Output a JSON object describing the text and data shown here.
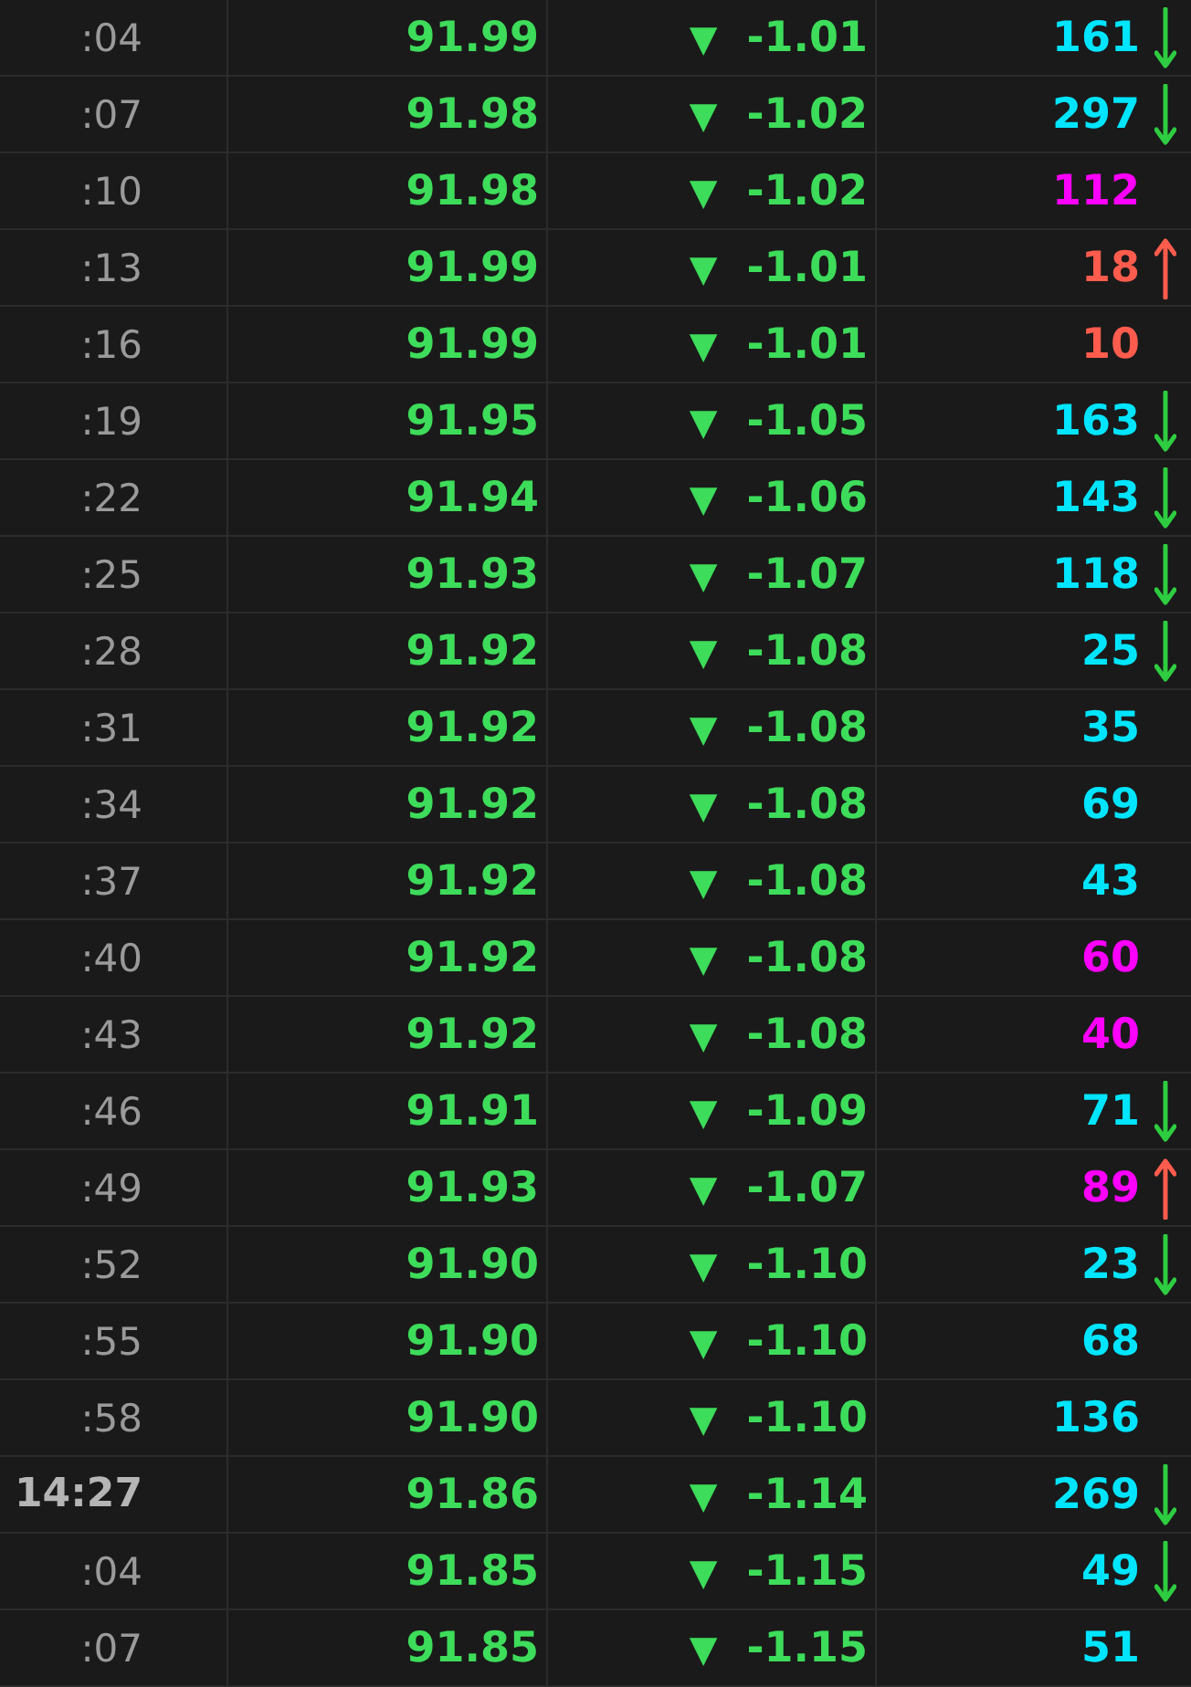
{
  "rows": [
    {
      "time": ":04",
      "time_bold": false,
      "price": "91.99",
      "change_mark": "▼",
      "change": "-1.01",
      "volume": "161",
      "color": "#00e5ff",
      "arrow_down": true,
      "arrow_up": false
    },
    {
      "time": ":07",
      "time_bold": false,
      "price": "91.98",
      "change_mark": "▼",
      "change": "-1.02",
      "volume": "297",
      "color": "#00e5ff",
      "arrow_down": true,
      "arrow_up": false
    },
    {
      "time": ":10",
      "time_bold": false,
      "price": "91.98",
      "change_mark": "▼",
      "change": "-1.02",
      "volume": "112",
      "color": "#ff00ff",
      "arrow_down": false,
      "arrow_up": false
    },
    {
      "time": ":13",
      "time_bold": false,
      "price": "91.99",
      "change_mark": "▼",
      "change": "-1.01",
      "volume": "18",
      "color": "#ff5c4d",
      "arrow_down": false,
      "arrow_up": true
    },
    {
      "time": ":16",
      "time_bold": false,
      "price": "91.99",
      "change_mark": "▼",
      "change": "-1.01",
      "volume": "10",
      "color": "#ff5c4d",
      "arrow_down": false,
      "arrow_up": false
    },
    {
      "time": ":19",
      "time_bold": false,
      "price": "91.95",
      "change_mark": "▼",
      "change": "-1.05",
      "volume": "163",
      "color": "#00e5ff",
      "arrow_down": true,
      "arrow_up": false
    },
    {
      "time": ":22",
      "time_bold": false,
      "price": "91.94",
      "change_mark": "▼",
      "change": "-1.06",
      "volume": "143",
      "color": "#00e5ff",
      "arrow_down": true,
      "arrow_up": false
    },
    {
      "time": ":25",
      "time_bold": false,
      "price": "91.93",
      "change_mark": "▼",
      "change": "-1.07",
      "volume": "118",
      "color": "#00e5ff",
      "arrow_down": true,
      "arrow_up": false
    },
    {
      "time": ":28",
      "time_bold": false,
      "price": "91.92",
      "change_mark": "▼",
      "change": "-1.08",
      "volume": "25",
      "color": "#00e5ff",
      "arrow_down": true,
      "arrow_up": false
    },
    {
      "time": ":31",
      "time_bold": false,
      "price": "91.92",
      "change_mark": "▼",
      "change": "-1.08",
      "volume": "35",
      "color": "#00e5ff",
      "arrow_down": false,
      "arrow_up": false
    },
    {
      "time": ":34",
      "time_bold": false,
      "price": "91.92",
      "change_mark": "▼",
      "change": "-1.08",
      "volume": "69",
      "color": "#00e5ff",
      "arrow_down": false,
      "arrow_up": false
    },
    {
      "time": ":37",
      "time_bold": false,
      "price": "91.92",
      "change_mark": "▼",
      "change": "-1.08",
      "volume": "43",
      "color": "#00e5ff",
      "arrow_down": false,
      "arrow_up": false
    },
    {
      "time": ":40",
      "time_bold": false,
      "price": "91.92",
      "change_mark": "▼",
      "change": "-1.08",
      "volume": "60",
      "color": "#ff00ff",
      "arrow_down": false,
      "arrow_up": false
    },
    {
      "time": ":43",
      "time_bold": false,
      "price": "91.92",
      "change_mark": "▼",
      "change": "-1.08",
      "volume": "40",
      "color": "#ff00ff",
      "arrow_down": false,
      "arrow_up": false
    },
    {
      "time": ":46",
      "time_bold": false,
      "price": "91.91",
      "change_mark": "▼",
      "change": "-1.09",
      "volume": "71",
      "color": "#00e5ff",
      "arrow_down": true,
      "arrow_up": false
    },
    {
      "time": ":49",
      "time_bold": false,
      "price": "91.93",
      "change_mark": "▼",
      "change": "-1.07",
      "volume": "89",
      "color": "#ff00ff",
      "arrow_down": false,
      "arrow_up": true
    },
    {
      "time": ":52",
      "time_bold": false,
      "price": "91.90",
      "change_mark": "▼",
      "change": "-1.10",
      "volume": "23",
      "color": "#00e5ff",
      "arrow_down": true,
      "arrow_up": false
    },
    {
      "time": ":55",
      "time_bold": false,
      "price": "91.90",
      "change_mark": "▼",
      "change": "-1.10",
      "volume": "68",
      "color": "#00e5ff",
      "arrow_down": false,
      "arrow_up": false
    },
    {
      "time": ":58",
      "time_bold": false,
      "price": "91.90",
      "change_mark": "▼",
      "change": "-1.10",
      "volume": "136",
      "color": "#00e5ff",
      "arrow_down": false,
      "arrow_up": false
    },
    {
      "time": "14:27",
      "time_bold": true,
      "price": "91.86",
      "change_mark": "▼",
      "change": "-1.14",
      "volume": "269",
      "color": "#00e5ff",
      "arrow_down": true,
      "arrow_up": false
    },
    {
      "time": ":04",
      "time_bold": false,
      "price": "91.85",
      "change_mark": "▼",
      "change": "-1.15",
      "volume": "49",
      "color": "#00e5ff",
      "arrow_down": true,
      "arrow_up": false
    },
    {
      "time": ":07",
      "time_bold": false,
      "price": "91.85",
      "change_mark": "▼",
      "change": "-1.15",
      "volume": "51",
      "color": "#00e5ff",
      "arrow_down": false,
      "arrow_up": false
    }
  ]
}
